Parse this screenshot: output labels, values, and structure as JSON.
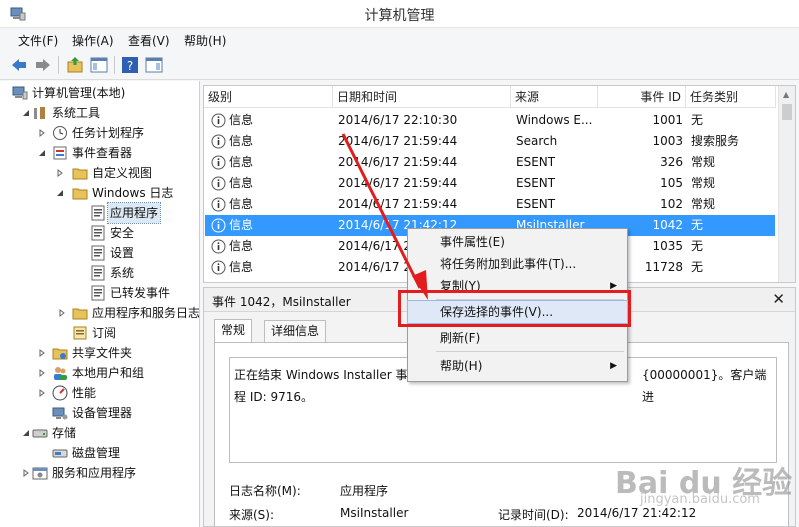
{
  "window": {
    "title": "计算机管理"
  },
  "menu": [
    "文件(F)",
    "操作(A)",
    "查看(V)",
    "帮助(H)"
  ],
  "tree": [
    {
      "label": "计算机管理(本地)",
      "icon": "computer-icon"
    },
    {
      "label": "系统工具",
      "icon": "tools-icon"
    },
    {
      "label": "任务计划程序",
      "icon": "clock-icon"
    },
    {
      "label": "事件查看器",
      "icon": "event-viewer-icon"
    },
    {
      "label": "自定义视图",
      "icon": "folder-icon"
    },
    {
      "label": "Windows 日志",
      "icon": "folder-icon"
    },
    {
      "label": "应用程序",
      "icon": "log-icon"
    },
    {
      "label": "安全",
      "icon": "log-icon"
    },
    {
      "label": "设置",
      "icon": "log-icon"
    },
    {
      "label": "系统",
      "icon": "log-icon"
    },
    {
      "label": "已转发事件",
      "icon": "log-icon"
    },
    {
      "label": "应用程序和服务日志",
      "icon": "folder-icon"
    },
    {
      "label": "订阅",
      "icon": "subscription-icon"
    },
    {
      "label": "共享文件夹",
      "icon": "shared-folder-icon"
    },
    {
      "label": "本地用户和组",
      "icon": "users-icon"
    },
    {
      "label": "性能",
      "icon": "performance-icon"
    },
    {
      "label": "设备管理器",
      "icon": "device-manager-icon"
    },
    {
      "label": "存储",
      "icon": "storage-icon"
    },
    {
      "label": "磁盘管理",
      "icon": "disk-icon"
    },
    {
      "label": "服务和应用程序",
      "icon": "services-icon"
    }
  ],
  "list": {
    "columns": [
      "级别",
      "日期和时间",
      "来源",
      "事件 ID",
      "任务类别"
    ],
    "rows": [
      [
        "信息",
        "2014/6/17 22:10:30",
        "Windows E...",
        "1001",
        "无"
      ],
      [
        "信息",
        "2014/6/17 21:59:44",
        "Search",
        "1003",
        "搜索服务"
      ],
      [
        "信息",
        "2014/6/17 21:59:44",
        "ESENT",
        "326",
        "常规"
      ],
      [
        "信息",
        "2014/6/17 21:59:44",
        "ESENT",
        "105",
        "常规"
      ],
      [
        "信息",
        "2014/6/17 21:59:44",
        "ESENT",
        "102",
        "常规"
      ],
      [
        "信息",
        "2014/6/17 21:42:12",
        "MsiInstaller",
        "1042",
        "无"
      ],
      [
        "信息",
        "2014/6/17 21:42:...",
        "",
        "1035",
        "无"
      ],
      [
        "信息",
        "2014/6/17 21:...",
        "",
        "11728",
        "无"
      ]
    ]
  },
  "detail": {
    "title": "事件 1042，MsiInstaller",
    "tabs": [
      "常规",
      "详细信息"
    ],
    "description_line1": "正在结束 Windows Installer 事务",
    "description_line1_right": "{00000001}。客户端进",
    "description_line2": "程 ID: 9716。",
    "log_name_label": "日志名称(M):",
    "log_name_value": "应用程序",
    "source_label": "来源(S):",
    "source_value": "MsiInstaller",
    "recorded_label": "记录时间(D):",
    "recorded_value": "2014/6/17 21:42:12"
  },
  "context_menu": {
    "items": [
      "事件属性(E)",
      "将任务附加到此事件(T)...",
      "复制(Y)",
      "保存选择的事件(V)...",
      "刷新(F)",
      "帮助(H)"
    ]
  },
  "watermark": {
    "brand": "Bai du 经验",
    "url": "jingyan.baidu.com"
  },
  "colors": {
    "selection": "#3399ff",
    "highlight_box": "#e31d1d",
    "menu_hover": "#dfe8f6"
  }
}
